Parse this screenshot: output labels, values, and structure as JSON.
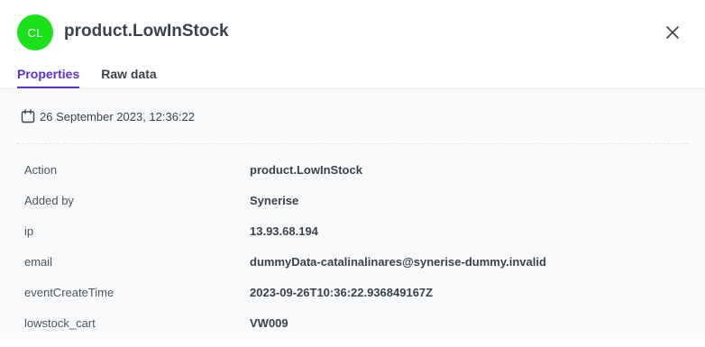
{
  "header": {
    "avatar_initials": "CL",
    "avatar_color": "#1be11b",
    "title": "product.LowInStock",
    "close_icon": "close-icon"
  },
  "tabs": [
    {
      "label": "Properties",
      "active": true
    },
    {
      "label": "Raw data",
      "active": false
    }
  ],
  "event": {
    "date_icon": "calendar-icon",
    "date": "26 September 2023, 12:36:22"
  },
  "properties": [
    {
      "key": "Action",
      "value": "product.LowInStock"
    },
    {
      "key": "Added by",
      "value": "Synerise"
    },
    {
      "key": "ip",
      "value": "13.93.68.194"
    },
    {
      "key": "email",
      "value": "dummyData-catalinalinares@synerise-dummy.invalid"
    },
    {
      "key": "eventCreateTime",
      "value": "2023-09-26T10:36:22.936849167Z"
    },
    {
      "key": "lowstock_cart",
      "value": "VW009"
    }
  ],
  "colors": {
    "accent": "#5b2fd4",
    "text": "#384350",
    "content_bg": "#f9fafb"
  }
}
